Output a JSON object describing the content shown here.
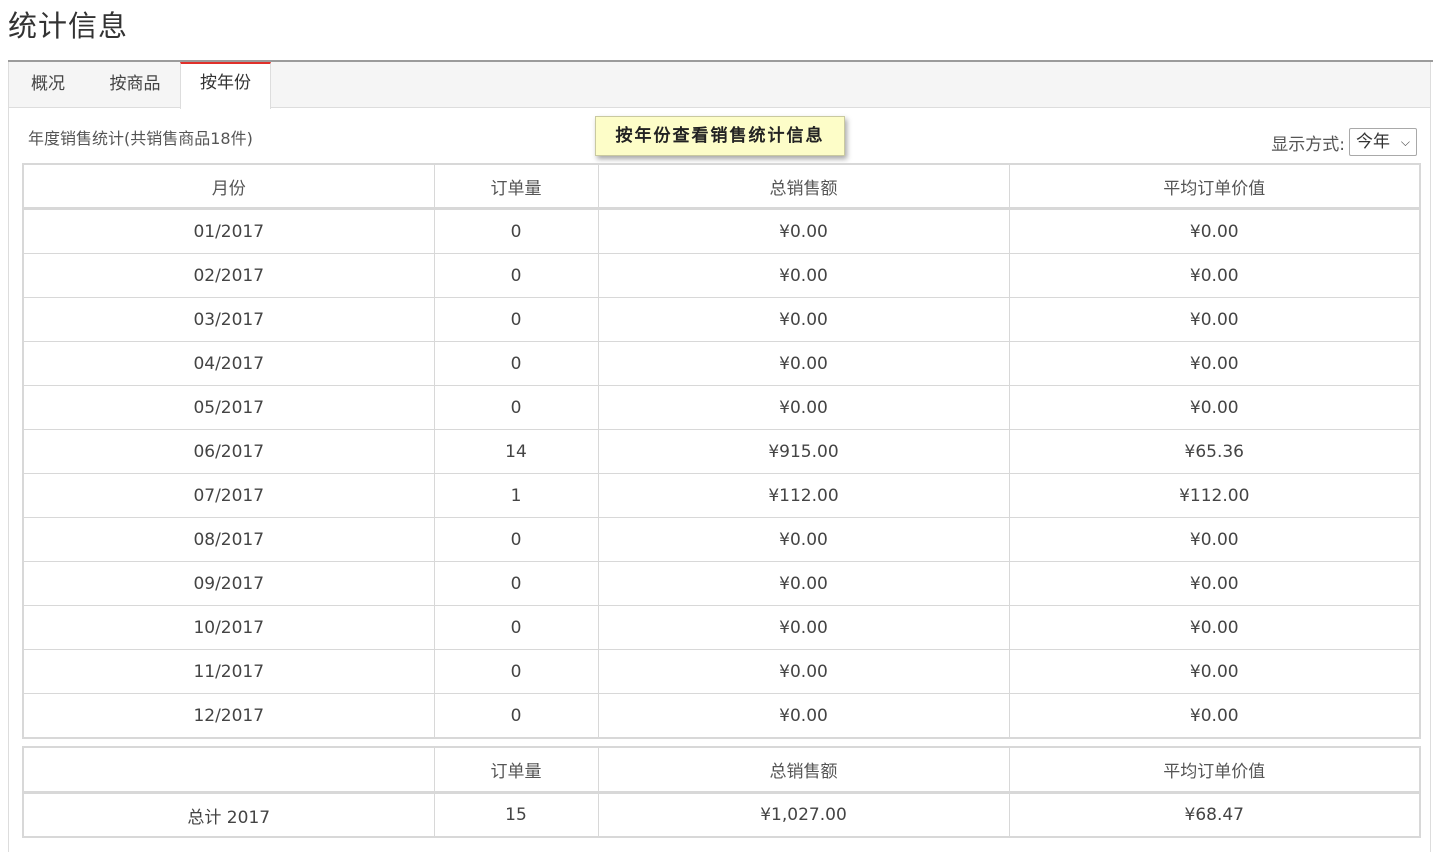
{
  "page": {
    "title": "统计信息"
  },
  "tabs": [
    {
      "label": "概况",
      "active": false
    },
    {
      "label": "按商品",
      "active": false
    },
    {
      "label": "按年份",
      "active": true
    }
  ],
  "summary": "年度销售统计(共销售商品18件)",
  "tooltip": "按年份查看销售统计信息",
  "display_mode": {
    "label": "显示方式:",
    "selected": "今年"
  },
  "monthly_table": {
    "columns": [
      "月份",
      "订单量",
      "总销售额",
      "平均订单价值"
    ],
    "rows": [
      [
        "01/2017",
        "0",
        "¥0.00",
        "¥0.00"
      ],
      [
        "02/2017",
        "0",
        "¥0.00",
        "¥0.00"
      ],
      [
        "03/2017",
        "0",
        "¥0.00",
        "¥0.00"
      ],
      [
        "04/2017",
        "0",
        "¥0.00",
        "¥0.00"
      ],
      [
        "05/2017",
        "0",
        "¥0.00",
        "¥0.00"
      ],
      [
        "06/2017",
        "14",
        "¥915.00",
        "¥65.36"
      ],
      [
        "07/2017",
        "1",
        "¥112.00",
        "¥112.00"
      ],
      [
        "08/2017",
        "0",
        "¥0.00",
        "¥0.00"
      ],
      [
        "09/2017",
        "0",
        "¥0.00",
        "¥0.00"
      ],
      [
        "10/2017",
        "0",
        "¥0.00",
        "¥0.00"
      ],
      [
        "11/2017",
        "0",
        "¥0.00",
        "¥0.00"
      ],
      [
        "12/2017",
        "0",
        "¥0.00",
        "¥0.00"
      ]
    ]
  },
  "totals_table": {
    "columns": [
      "",
      "订单量",
      "总销售额",
      "平均订单价值"
    ],
    "row": [
      "总计 2017",
      "15",
      "¥1,027.00",
      "¥68.47"
    ]
  },
  "colors": {
    "active_tab_accent": "#e0302b",
    "tooltip_bg": "#fdfdc8"
  },
  "icons": {
    "select_chevron": "chevron-down-icon"
  }
}
